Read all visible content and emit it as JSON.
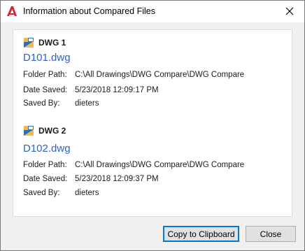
{
  "window": {
    "title": "Information about Compared Files",
    "app_icon": "autocad-a-icon",
    "close_icon": "close-icon"
  },
  "files": [
    {
      "header": "DWG 1",
      "icon": "dwg-file-icon",
      "filename": "D101.dwg",
      "folder_label": "Folder Path:",
      "folder_value": "C:\\All Drawings\\DWG Compare\\DWG Compare",
      "date_label": "Date Saved:",
      "date_value": "5/23/2018 12:09:17 PM",
      "saved_by_label": "Saved By:",
      "saved_by_value": "dieters"
    },
    {
      "header": "DWG 2",
      "icon": "dwg-file-icon",
      "filename": "D102.dwg",
      "folder_label": "Folder Path:",
      "folder_value": "C:\\All Drawings\\DWG Compare\\DWG Compare",
      "date_label": "Date Saved:",
      "date_value": "5/23/2018 12:09:37 PM",
      "saved_by_label": "Saved By:",
      "saved_by_value": "dieters"
    }
  ],
  "buttons": {
    "copy_label": "Copy to Clipboard",
    "close_label": "Close"
  },
  "colors": {
    "link": "#2a64c5",
    "app_icon_red": "#d8232a",
    "focus_border": "#0078d7"
  }
}
